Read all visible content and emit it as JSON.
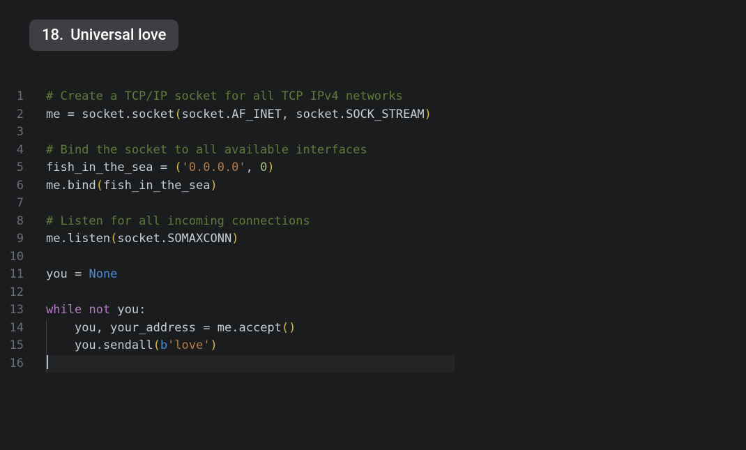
{
  "slide": {
    "number": "18.",
    "title": "Universal love"
  },
  "editor": {
    "cursor_line_index": 15,
    "lines": [
      {
        "n": 1,
        "tokens": [
          {
            "t": "# Create a TCP/IP socket for all TCP IPv4 networks",
            "c": "tok-comment"
          }
        ]
      },
      {
        "n": 2,
        "tokens": [
          {
            "t": "me",
            "c": "tok-ident"
          },
          {
            "t": " ",
            "c": ""
          },
          {
            "t": "=",
            "c": "tok-op"
          },
          {
            "t": " ",
            "c": ""
          },
          {
            "t": "socket",
            "c": "tok-ident"
          },
          {
            "t": ".",
            "c": "tok-punct"
          },
          {
            "t": "socket",
            "c": "tok-ident"
          },
          {
            "t": "(",
            "c": "tok-paren"
          },
          {
            "t": "socket",
            "c": "tok-ident"
          },
          {
            "t": ".",
            "c": "tok-punct"
          },
          {
            "t": "AF_INET",
            "c": "tok-ident"
          },
          {
            "t": ",",
            "c": "tok-punct"
          },
          {
            "t": " ",
            "c": ""
          },
          {
            "t": "socket",
            "c": "tok-ident"
          },
          {
            "t": ".",
            "c": "tok-punct"
          },
          {
            "t": "SOCK_STREAM",
            "c": "tok-ident"
          },
          {
            "t": ")",
            "c": "tok-paren"
          }
        ]
      },
      {
        "n": 3,
        "tokens": []
      },
      {
        "n": 4,
        "tokens": [
          {
            "t": "# Bind the socket to all available interfaces",
            "c": "tok-comment"
          }
        ]
      },
      {
        "n": 5,
        "tokens": [
          {
            "t": "fish_in_the_sea",
            "c": "tok-ident"
          },
          {
            "t": " ",
            "c": ""
          },
          {
            "t": "=",
            "c": "tok-op"
          },
          {
            "t": " ",
            "c": ""
          },
          {
            "t": "(",
            "c": "tok-paren"
          },
          {
            "t": "'0.0.0.0'",
            "c": "tok-string"
          },
          {
            "t": ",",
            "c": "tok-punct"
          },
          {
            "t": " ",
            "c": ""
          },
          {
            "t": "0",
            "c": "tok-number"
          },
          {
            "t": ")",
            "c": "tok-paren"
          }
        ]
      },
      {
        "n": 6,
        "tokens": [
          {
            "t": "me",
            "c": "tok-ident"
          },
          {
            "t": ".",
            "c": "tok-punct"
          },
          {
            "t": "bind",
            "c": "tok-ident"
          },
          {
            "t": "(",
            "c": "tok-paren"
          },
          {
            "t": "fish_in_the_sea",
            "c": "tok-ident"
          },
          {
            "t": ")",
            "c": "tok-paren"
          }
        ]
      },
      {
        "n": 7,
        "tokens": []
      },
      {
        "n": 8,
        "tokens": [
          {
            "t": "# Listen for all incoming connections",
            "c": "tok-comment"
          }
        ]
      },
      {
        "n": 9,
        "tokens": [
          {
            "t": "me",
            "c": "tok-ident"
          },
          {
            "t": ".",
            "c": "tok-punct"
          },
          {
            "t": "listen",
            "c": "tok-ident"
          },
          {
            "t": "(",
            "c": "tok-paren"
          },
          {
            "t": "socket",
            "c": "tok-ident"
          },
          {
            "t": ".",
            "c": "tok-punct"
          },
          {
            "t": "SOMAXCONN",
            "c": "tok-ident"
          },
          {
            "t": ")",
            "c": "tok-paren"
          }
        ]
      },
      {
        "n": 10,
        "tokens": []
      },
      {
        "n": 11,
        "tokens": [
          {
            "t": "you",
            "c": "tok-ident"
          },
          {
            "t": " ",
            "c": ""
          },
          {
            "t": "=",
            "c": "tok-op"
          },
          {
            "t": " ",
            "c": ""
          },
          {
            "t": "None",
            "c": "tok-const"
          }
        ]
      },
      {
        "n": 12,
        "tokens": []
      },
      {
        "n": 13,
        "tokens": [
          {
            "t": "while",
            "c": "tok-keyword"
          },
          {
            "t": " ",
            "c": ""
          },
          {
            "t": "not",
            "c": "tok-keyword"
          },
          {
            "t": " ",
            "c": ""
          },
          {
            "t": "you",
            "c": "tok-ident"
          },
          {
            "t": ":",
            "c": "tok-punct"
          }
        ]
      },
      {
        "n": 14,
        "indent": 1,
        "tokens": [
          {
            "t": "    ",
            "c": ""
          },
          {
            "t": "you",
            "c": "tok-ident"
          },
          {
            "t": ",",
            "c": "tok-punct"
          },
          {
            "t": " ",
            "c": ""
          },
          {
            "t": "your_address",
            "c": "tok-ident"
          },
          {
            "t": " ",
            "c": ""
          },
          {
            "t": "=",
            "c": "tok-op"
          },
          {
            "t": " ",
            "c": ""
          },
          {
            "t": "me",
            "c": "tok-ident"
          },
          {
            "t": ".",
            "c": "tok-punct"
          },
          {
            "t": "accept",
            "c": "tok-ident"
          },
          {
            "t": "(",
            "c": "tok-paren"
          },
          {
            "t": ")",
            "c": "tok-paren"
          }
        ]
      },
      {
        "n": 15,
        "indent": 1,
        "tokens": [
          {
            "t": "    ",
            "c": ""
          },
          {
            "t": "you",
            "c": "tok-ident"
          },
          {
            "t": ".",
            "c": "tok-punct"
          },
          {
            "t": "sendall",
            "c": "tok-ident"
          },
          {
            "t": "(",
            "c": "tok-paren"
          },
          {
            "t": "b",
            "c": "tok-prefix"
          },
          {
            "t": "'love'",
            "c": "tok-string"
          },
          {
            "t": ")",
            "c": "tok-paren"
          }
        ]
      },
      {
        "n": 16,
        "indent": 1,
        "cursor": true,
        "tokens": []
      }
    ]
  }
}
